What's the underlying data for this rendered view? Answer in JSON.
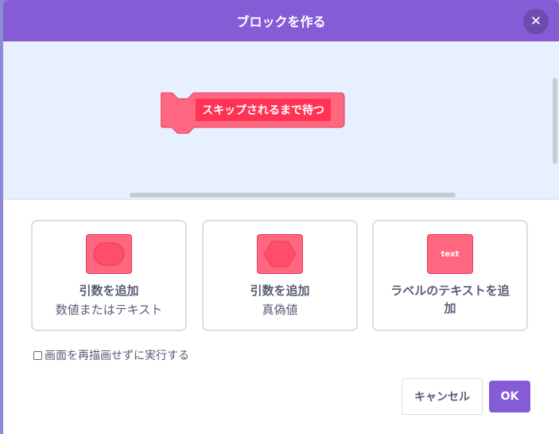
{
  "dialog": {
    "title": "ブロックを作る",
    "close_icon": "close-icon"
  },
  "workspace": {
    "block_label": "スキップされるまで待つ"
  },
  "options": [
    {
      "title": "引数を追加",
      "subtitle": "数値またはテキスト",
      "icon": "round-input-icon"
    },
    {
      "title": "引数を追加",
      "subtitle": "真偽値",
      "icon": "boolean-input-icon"
    },
    {
      "title": "ラベルのテキストを追加",
      "icon_text": "text"
    }
  ],
  "run_without_refresh": {
    "label": "画面を再描画せずに実行する",
    "checked": false
  },
  "buttons": {
    "cancel": "キャンセル",
    "ok": "OK"
  },
  "colors": {
    "header": "#855cd6",
    "block": "#ff6680",
    "block_label_bg": "#ff3355",
    "workspace_bg": "#e6f0ff"
  }
}
